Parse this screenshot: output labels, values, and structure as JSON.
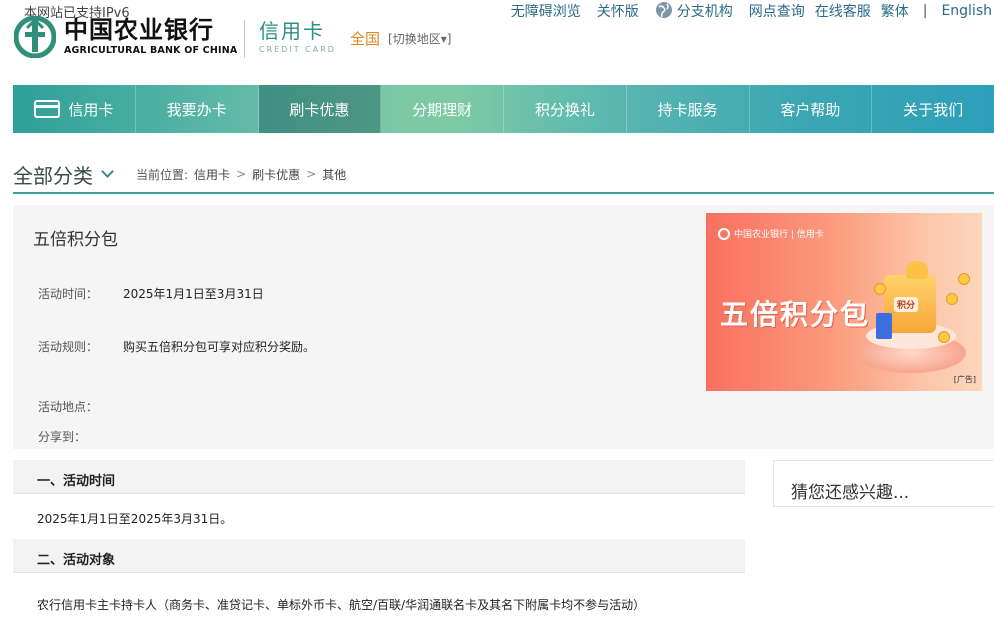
{
  "header": {
    "ipv6_notice": "本网站已支持IPv6",
    "logo_cn": "中国农业银行",
    "logo_en": "AGRICULTURAL BANK OF CHINA",
    "credit_cn": "信用卡",
    "credit_en": "CREDIT CARD",
    "region": "全国",
    "region_switch": "[切换地区▾]",
    "links": {
      "accessible": "无障碍浏览",
      "care": "关怀版",
      "branches": "分支机构",
      "network": "网点查询",
      "service": "在线客服",
      "traditional": "繁体",
      "separator": "|",
      "english": "English"
    }
  },
  "nav": {
    "items": [
      {
        "label": "信用卡"
      },
      {
        "label": "我要办卡"
      },
      {
        "label": "刷卡优惠"
      },
      {
        "label": "分期理财"
      },
      {
        "label": "积分换礼"
      },
      {
        "label": "持卡服务"
      },
      {
        "label": "客户帮助"
      },
      {
        "label": "关于我们"
      }
    ],
    "active_index": 2
  },
  "breadcrumb": {
    "all_categories": "全部分类",
    "current_position": "当前位置:",
    "items": [
      "信用卡",
      "刷卡优惠",
      "其他"
    ],
    "arrow": ">"
  },
  "activity": {
    "title": "五倍积分包",
    "time_label": "活动时间：",
    "time_value": "2025年1月1日至3月31日",
    "rule_label": "活动规则：",
    "rule_value": "购买五倍积分包可享对应积分奖励。",
    "place_label": "活动地点：",
    "share_label": "分享到："
  },
  "banner": {
    "logo_text": "中国农业银行 | 信用卡",
    "headline": "五倍积分包",
    "gift_label": "积分",
    "ad_tag": "[广告]"
  },
  "detail": {
    "sections": [
      {
        "heading": "一、活动时间",
        "body": "2025年1月1日至2025年3月31日。"
      },
      {
        "heading": "二、活动对象",
        "body": "农行信用卡主卡持卡人（商务卡、准贷记卡、单标外币卡、航空/百联/华润通联名卡及其名下附属卡均不参与活动）"
      }
    ]
  },
  "sidebar": {
    "interest_title": "猜您还感兴趣..."
  },
  "colors": {
    "brand_green": "#2f8f87",
    "nav_gradient_start": "#2f9f9a",
    "nav_gradient_end": "#2d9fba",
    "region_orange": "#d48a1c",
    "banner_red": "#f87060"
  }
}
